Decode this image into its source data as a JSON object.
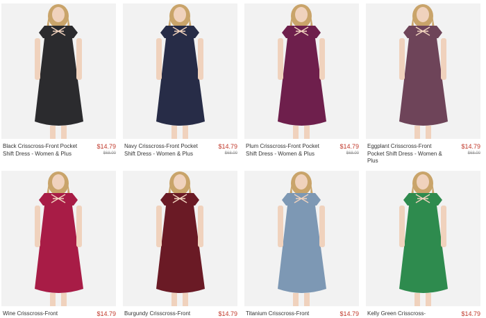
{
  "products": [
    {
      "name": "Black Crisscross-Front Pocket Shift Dress - Women & Plus",
      "price": "$14.79",
      "original_price": "$68.00",
      "color": "#2b2b2e"
    },
    {
      "name": "Navy Crisscross-Front Pocket Shift Dress - Women & Plus",
      "price": "$14.79",
      "original_price": "$68.00",
      "color": "#272c47"
    },
    {
      "name": "Plum Crisscross-Front Pocket Shift Dress - Women & Plus",
      "price": "$14.79",
      "original_price": "$68.00",
      "color": "#6e1f4c"
    },
    {
      "name": "Eggplant Crisscross-Front Pocket Shift Dress - Women & Plus",
      "price": "$14.79",
      "original_price": "$68.00",
      "color": "#6e4459"
    },
    {
      "name": "Wine Crisscross-Front",
      "price": "$14.79",
      "original_price": "",
      "color": "#a81c46"
    },
    {
      "name": "Burgundy Crisscross-Front",
      "price": "$14.79",
      "original_price": "",
      "color": "#6a1a25"
    },
    {
      "name": "Titanium Crisscross-Front",
      "price": "$14.79",
      "original_price": "",
      "color": "#7d98b4"
    },
    {
      "name": "Kelly Green Crisscross-",
      "price": "$14.79",
      "original_price": "",
      "color": "#2e8b4e"
    }
  ]
}
